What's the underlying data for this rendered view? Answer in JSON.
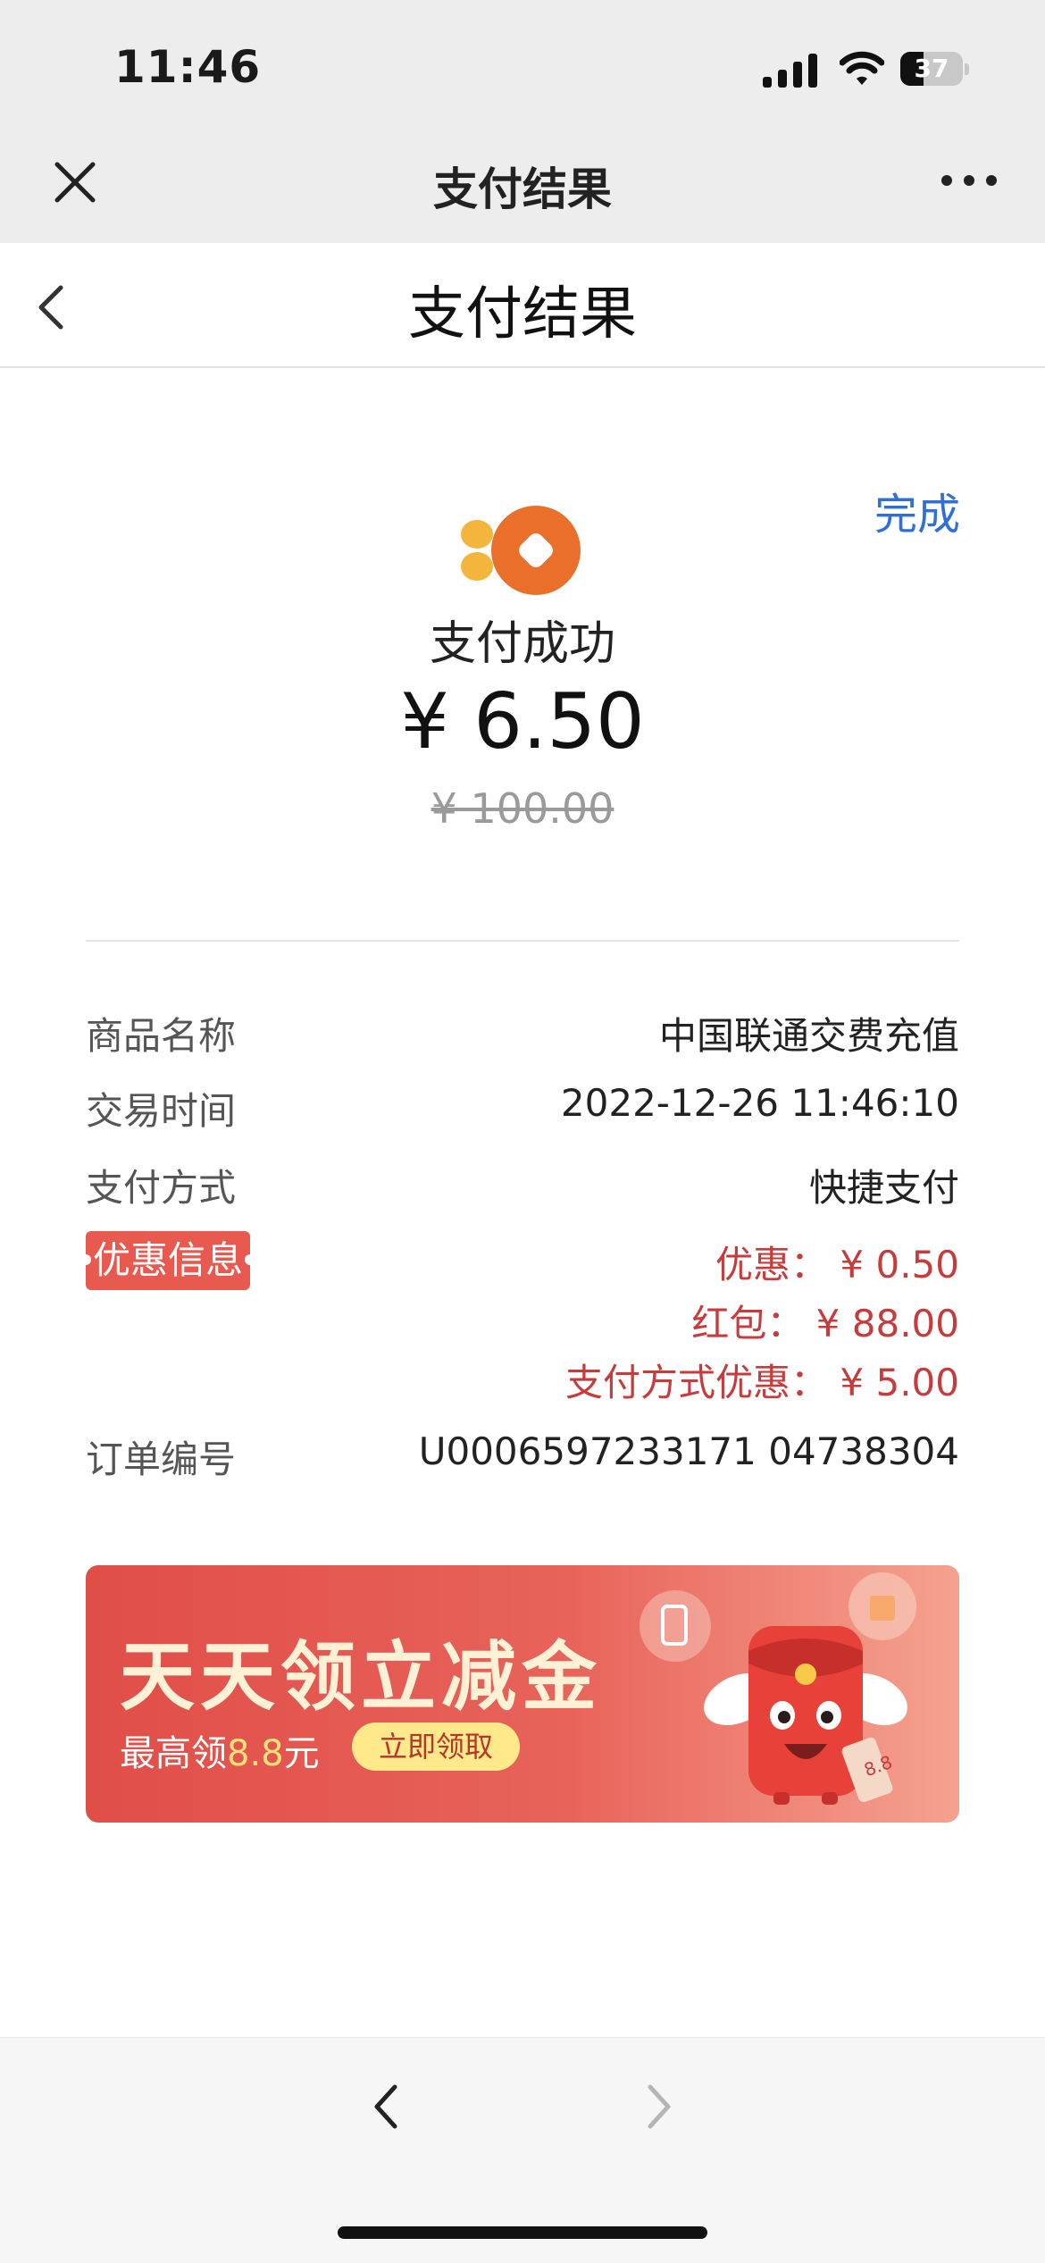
{
  "status_bar": {
    "time": "11:46",
    "battery": "37",
    "battery_level": 0.37
  },
  "top_bar": {
    "title": "支付结果"
  },
  "header": {
    "title": "支付结果"
  },
  "result": {
    "done_label": "完成",
    "status": "支付成功",
    "amount": "¥ 6.50",
    "original_amount": "¥ 100.00"
  },
  "details": {
    "product_label": "商品名称",
    "product_value": "中国联通交费充值",
    "time_label": "交易时间",
    "time_value": "2022-12-26 11:46:10",
    "method_label": "支付方式",
    "method_value": "快捷支付",
    "discount_label": "优惠信息",
    "discounts": [
      "优惠：  ¥ 0.50",
      "红包：  ¥ 88.00",
      "支付方式优惠：  ¥ 5.00"
    ],
    "order_label": "订单编号",
    "order_value": "U0006597233171 04738304"
  },
  "banner": {
    "title": "天天领立减金",
    "sub_prefix": "最高领",
    "sub_amount": "8.8",
    "sub_suffix": "元",
    "button": "立即领取",
    "ticket_text": "8.8"
  },
  "colors": {
    "accent_blue": "#2f6fd6",
    "discount_red": "#c63b3b",
    "banner_red": "#e04e48"
  },
  "icons": [
    "close-icon",
    "more-icon",
    "back-icon",
    "payment-logo-icon",
    "nav-back-icon",
    "nav-forward-icon"
  ]
}
